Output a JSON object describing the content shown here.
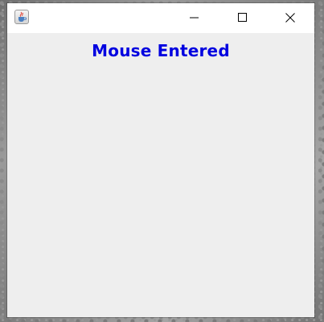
{
  "window": {
    "content_background": "#eeeeee",
    "titlebar_background": "#ffffff"
  },
  "titlebar": {
    "icon": "java-coffee-cup-icon",
    "controls": {
      "minimize_icon": "minimize-icon",
      "maximize_icon": "maximize-icon",
      "close_icon": "close-icon"
    }
  },
  "content": {
    "status_text": "Mouse Entered",
    "status_color": "#0000e0"
  }
}
